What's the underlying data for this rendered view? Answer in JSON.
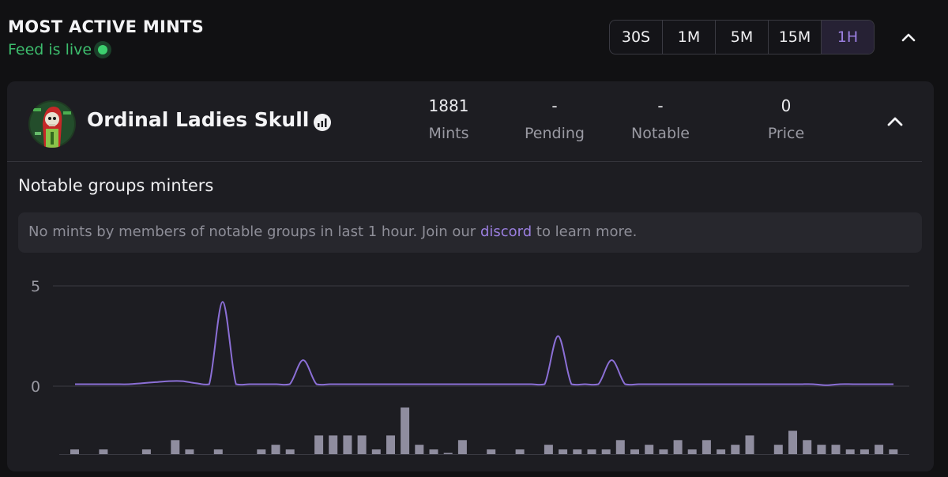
{
  "header": {
    "title": "MOST ACTIVE MINTS",
    "feed_status": "Feed is live",
    "live_color": "#3ccf6e"
  },
  "time_filter": {
    "options": [
      "30S",
      "1M",
      "5M",
      "15M",
      "1H"
    ],
    "selected": "1H",
    "accent": "#9b7fe0"
  },
  "collection": {
    "name": "Ordinal Ladies Skull",
    "stats": [
      {
        "value": "1881",
        "label": "Mints"
      },
      {
        "value": "-",
        "label": "Pending"
      },
      {
        "value": "-",
        "label": "Notable"
      },
      {
        "value": "0",
        "label": "Price"
      }
    ]
  },
  "notable_groups": {
    "title": "Notable groups minters",
    "notice_before": "No mints by members of notable groups in last 1 hour. Join our ",
    "notice_link": "discord",
    "notice_after": " to learn more."
  },
  "chart_data": [
    {
      "type": "line",
      "y_ticks": [
        "5",
        "0"
      ],
      "ylim": [
        0,
        5
      ],
      "line_color": "#8b6fd6",
      "values": [
        0.1,
        0.1,
        0.1,
        0.1,
        0.1,
        0.15,
        0.2,
        0.25,
        0.25,
        0.15,
        0.1,
        4.2,
        0.1,
        0.1,
        0.1,
        0.1,
        0.1,
        1.3,
        0.1,
        0.1,
        0.1,
        0.1,
        0.1,
        0.1,
        0.1,
        0.1,
        0.1,
        0.1,
        0.1,
        0.1,
        0.1,
        0.1,
        0.1,
        0.1,
        0.1,
        0.1,
        2.5,
        0.1,
        0.1,
        0.1,
        1.3,
        0.1,
        0.1,
        0.1,
        0.1,
        0.1,
        0.1,
        0.1,
        0.1,
        0.1,
        0.1,
        0.1,
        0.1,
        0.1,
        0.1,
        0.1,
        0.05,
        0.1,
        0.1,
        0.1,
        0.1,
        0.1
      ]
    },
    {
      "type": "bar",
      "bar_color": "#8f8d9f",
      "values": [
        1,
        0,
        1,
        0,
        0,
        1,
        0,
        3,
        1,
        0,
        1,
        0,
        0,
        1,
        2,
        1,
        0,
        4,
        4,
        4,
        4,
        1,
        4,
        10,
        2,
        1,
        0.2,
        3,
        0,
        1,
        0,
        1,
        0,
        2,
        1,
        1,
        1,
        1,
        3,
        1,
        2,
        1,
        3,
        1,
        3,
        1,
        2,
        4,
        0,
        2,
        5,
        3,
        2,
        2,
        1,
        1,
        2,
        1
      ]
    }
  ]
}
